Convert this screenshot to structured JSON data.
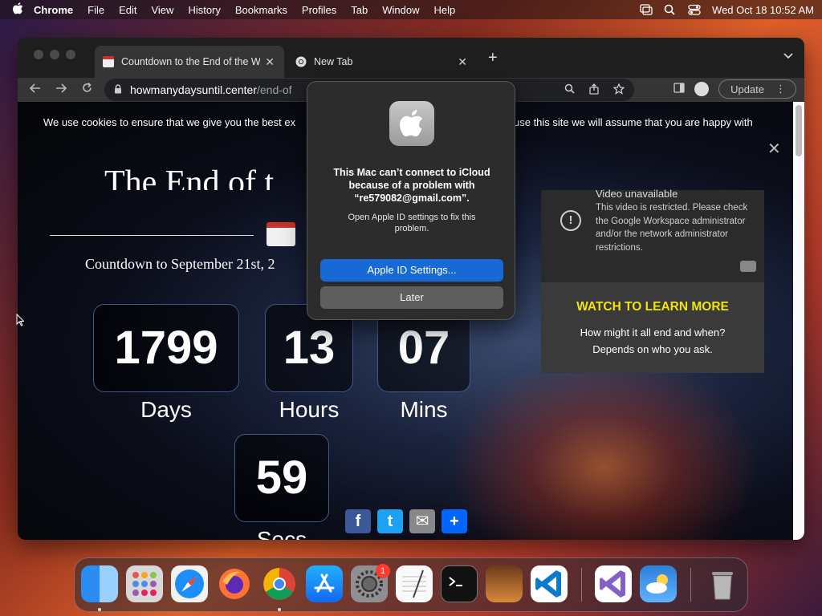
{
  "menubar": {
    "apple_icon": "apple-icon",
    "app_name": "Chrome",
    "menus": [
      "File",
      "Edit",
      "View",
      "History",
      "Bookmarks",
      "Profiles",
      "Tab",
      "Window",
      "Help"
    ],
    "clock": "Wed Oct 18  10:52 AM",
    "status_icons": [
      "screen-mirroring-icon",
      "spotlight-search-icon",
      "control-center-icon"
    ]
  },
  "browser": {
    "tabs": [
      {
        "title": "Countdown to the End of the W",
        "favicon": "calendar-icon",
        "active": true
      },
      {
        "title": "New Tab",
        "favicon": "chrome-icon",
        "active": false
      }
    ],
    "new_tab": "+",
    "url_host": "howmanydaysuntil.center",
    "url_path": "/end-of",
    "update_label": "Update"
  },
  "page": {
    "cookie_text_left": "We use cookies to ensure that we give you the best ex",
    "cookie_text_right": "use this site we will assume that you are happy with",
    "cookie_close": "✕",
    "headline": "The End of t",
    "countdown_to": "Countdown to September 21st, 2",
    "counters": [
      {
        "value": "1799",
        "unit": "Days"
      },
      {
        "value": "13",
        "unit": "Hours"
      },
      {
        "value": "07",
        "unit": "Mins"
      },
      {
        "value": "59",
        "unit": "Secs"
      }
    ],
    "video": {
      "title": "Video unavailable",
      "message": "This video is restricted. Please check the Google Workspace administrator and/or the network administrator restrictions.",
      "watch": "WATCH TO LEARN MORE",
      "sub_line1": "How might it all end and when?",
      "sub_line2": "Depends on who you ask."
    },
    "share": [
      {
        "name": "facebook",
        "glyph": "f",
        "color": "#3b5998"
      },
      {
        "name": "twitter",
        "glyph": "t",
        "color": "#1da1f2"
      },
      {
        "name": "email",
        "glyph": "✉",
        "color": "#888888"
      },
      {
        "name": "share",
        "glyph": "+",
        "color": "#0166ff"
      }
    ]
  },
  "dialog": {
    "title": "This Mac can’t connect to iCloud because of a problem with “re579082@gmail.com”.",
    "message": "Open Apple ID settings to fix this problem.",
    "primary": "Apple ID Settings...",
    "secondary": "Later"
  },
  "dock": {
    "apps": [
      "finder",
      "launchpad",
      "safari",
      "firefox",
      "chrome",
      "app-store",
      "system-settings",
      "textedit",
      "terminal",
      "garageband",
      "vscode",
      "visual-studio",
      "weather",
      "trash"
    ],
    "settings_badge": "1"
  }
}
